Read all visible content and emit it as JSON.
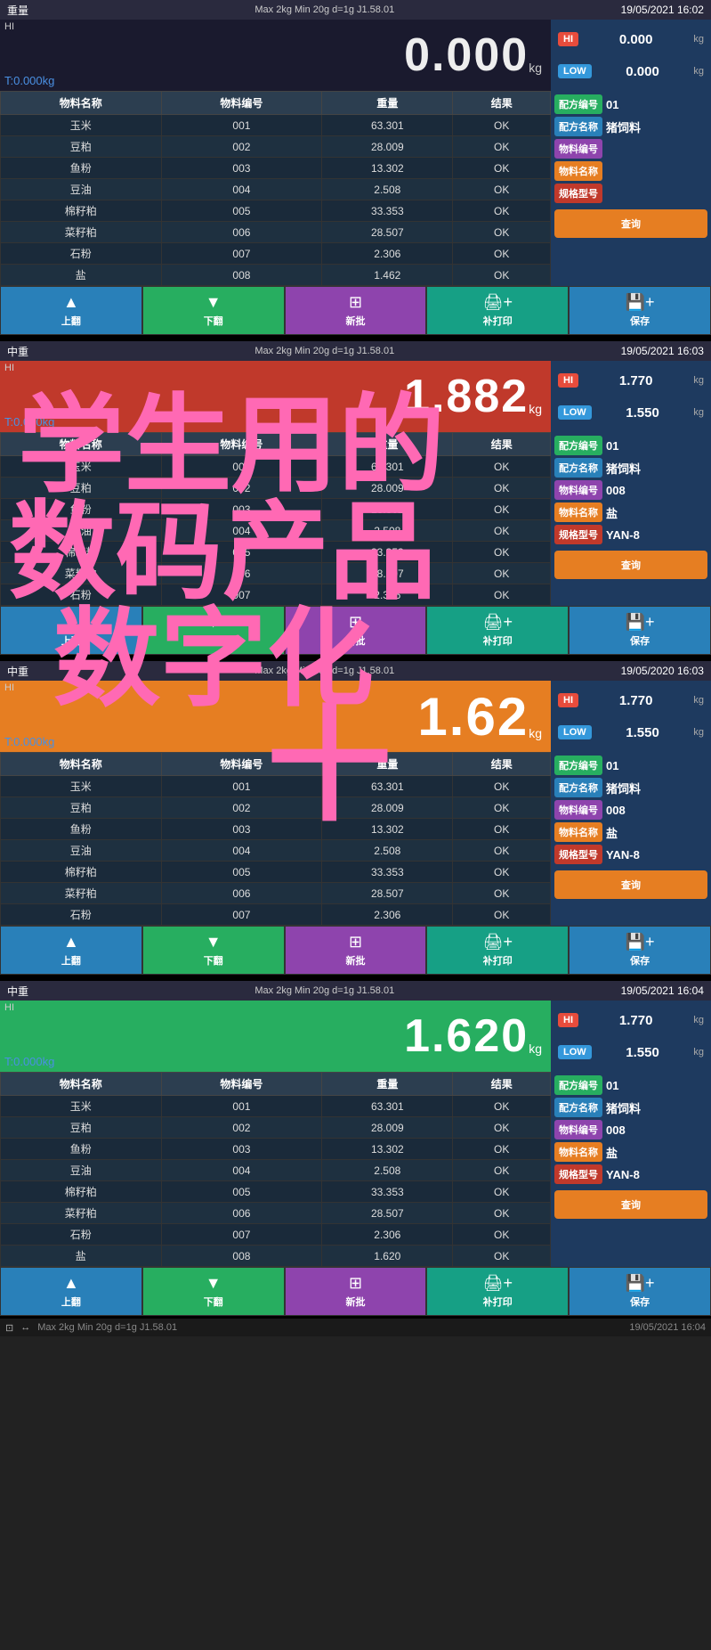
{
  "panels": [
    {
      "id": "panel1",
      "topbar": {
        "left": "重量",
        "center": "Max 2kg  Min 20g  d=1g  J1.58.01",
        "right": "19/05/2021  16:02"
      },
      "weight": {
        "label": "HI",
        "value": "0.000",
        "unit": "kg",
        "ref": "T:0.000kg",
        "hi": "0.000",
        "low": "0.000",
        "weightClass": ""
      },
      "tableHeaders": [
        "物料名称",
        "物料编号",
        "重量",
        "结果"
      ],
      "tableRows": [
        [
          "玉米",
          "001",
          "63.301",
          "OK"
        ],
        [
          "豆粕",
          "002",
          "28.009",
          "OK"
        ],
        [
          "鱼粉",
          "003",
          "13.302",
          "OK"
        ],
        [
          "豆油",
          "004",
          "2.508",
          "OK"
        ],
        [
          "棉籽粕",
          "005",
          "33.353",
          "OK"
        ],
        [
          "菜籽粕",
          "006",
          "28.507",
          "OK"
        ],
        [
          "石粉",
          "007",
          "2.306",
          "OK"
        ],
        [
          "盐",
          "008",
          "1.462",
          "OK"
        ]
      ],
      "rightPanel": {
        "recipeNo": "01",
        "recipeName": "猪饲料",
        "materialNo": "",
        "materialName": "",
        "specModel": "",
        "showQuery": true,
        "showAll": false
      },
      "toolbar": {
        "btn1": "上翻",
        "btn2": "下翻",
        "btn3": "新批",
        "btn4": "补打印",
        "btn5": "保存",
        "queryLabel": "查询"
      }
    },
    {
      "id": "panel2",
      "topbar": {
        "left": "中重",
        "center": "Max 2kg  Min 20g  d=1g  J1.58.01",
        "right": "19/05/2021  16:03"
      },
      "weight": {
        "label": "HI",
        "value": "1.882",
        "unit": "kg",
        "ref": "T:0.000kg",
        "hi": "1.770",
        "low": "1.550",
        "weightClass": "active-red"
      },
      "tableHeaders": [
        "物料名称",
        "物料编号",
        "重量",
        "结果"
      ],
      "tableRows": [
        [
          "玉米",
          "001",
          "63.301",
          "OK"
        ],
        [
          "豆粕",
          "002",
          "28.009",
          "OK"
        ],
        [
          "鱼粉",
          "003",
          "13.302",
          "OK"
        ],
        [
          "豆油",
          "004",
          "2.508",
          "OK"
        ],
        [
          "棉籽粕",
          "005",
          "33.353",
          "OK"
        ],
        [
          "菜籽粕",
          "006",
          "28.507",
          "OK"
        ],
        [
          "石粉",
          "007",
          "2.306",
          "OK"
        ]
      ],
      "rightPanel": {
        "recipeNo": "01",
        "recipeName": "猪饲料",
        "materialNo": "008",
        "materialName": "盐",
        "specModel": "YAN-8",
        "showQuery": true,
        "showAll": true
      },
      "toolbar": {
        "btn1": "上翻",
        "btn2": "下翻",
        "btn3": "新批",
        "btn4": "补打印",
        "btn5": "保存",
        "queryLabel": "查询"
      }
    },
    {
      "id": "panel3",
      "topbar": {
        "left": "中重",
        "center": "Max 2kg  Min 20g  d=1g  J1.58.01",
        "right": "19/05/2020  16:03"
      },
      "weight": {
        "label": "HI",
        "value": "1.62",
        "unit": "kg",
        "ref": "T:0.000kg",
        "hi": "1.770",
        "low": "1.550",
        "weightClass": "active-orange"
      },
      "tableHeaders": [
        "物料名称",
        "物料编号",
        "重量",
        "结果"
      ],
      "tableRows": [
        [
          "玉米",
          "001",
          "63.301",
          "OK"
        ],
        [
          "豆粕",
          "002",
          "28.009",
          "OK"
        ],
        [
          "鱼粉",
          "003",
          "13.302",
          "OK"
        ],
        [
          "豆油",
          "004",
          "2.508",
          "OK"
        ],
        [
          "棉籽粕",
          "005",
          "33.353",
          "OK"
        ],
        [
          "菜籽粕",
          "006",
          "28.507",
          "OK"
        ],
        [
          "石粉",
          "007",
          "2.306",
          "OK"
        ]
      ],
      "rightPanel": {
        "recipeNo": "01",
        "recipeName": "猪饲料",
        "materialNo": "008",
        "materialName": "盐",
        "specModel": "YAN-8",
        "showQuery": true,
        "showAll": true
      },
      "toolbar": {
        "btn1": "上翻",
        "btn2": "下翻",
        "btn3": "新批",
        "btn4": "补打印",
        "btn5": "保存",
        "queryLabel": "查询"
      }
    },
    {
      "id": "panel4",
      "topbar": {
        "left": "中重",
        "center": "Max 2kg  Min 20g  d=1g  J1.58.01",
        "right": "19/05/2021  16:04"
      },
      "weight": {
        "label": "HI",
        "value": "1.620",
        "unit": "kg",
        "ref": "T:0.000kg",
        "hi": "1.770",
        "low": "1.550",
        "weightClass": "active-green"
      },
      "tableHeaders": [
        "物料名称",
        "物料编号",
        "重量",
        "结果"
      ],
      "tableRows": [
        [
          "玉米",
          "001",
          "63.301",
          "OK"
        ],
        [
          "豆粕",
          "002",
          "28.009",
          "OK"
        ],
        [
          "鱼粉",
          "003",
          "13.302",
          "OK"
        ],
        [
          "豆油",
          "004",
          "2.508",
          "OK"
        ],
        [
          "棉籽粕",
          "005",
          "33.353",
          "OK"
        ],
        [
          "菜籽粕",
          "006",
          "28.507",
          "OK"
        ],
        [
          "石粉",
          "007",
          "2.306",
          "OK"
        ],
        [
          "盐",
          "008",
          "1.620",
          "OK"
        ]
      ],
      "rightPanel": {
        "recipeNo": "01",
        "recipeName": "猪饲料",
        "materialNo": "008",
        "materialName": "盐",
        "specModel": "YAN-8",
        "showQuery": true,
        "showAll": true
      },
      "toolbar": {
        "btn1": "上翻",
        "btn2": "下翻",
        "btn3": "新批",
        "btn4": "补打印",
        "btn5": "保存",
        "queryLabel": "查询"
      }
    }
  ],
  "watermark": {
    "line1": "学生用的",
    "line2": "数码产品",
    "line3": "数字化",
    "line4": "十",
    "color": "#ff69b4"
  },
  "statusBar": {
    "icons": [
      "⊡",
      "↔"
    ],
    "text": "Max 2kg  Min 20g  d=1g  J1.58.01",
    "right": "19/05/2021  16:04"
  }
}
